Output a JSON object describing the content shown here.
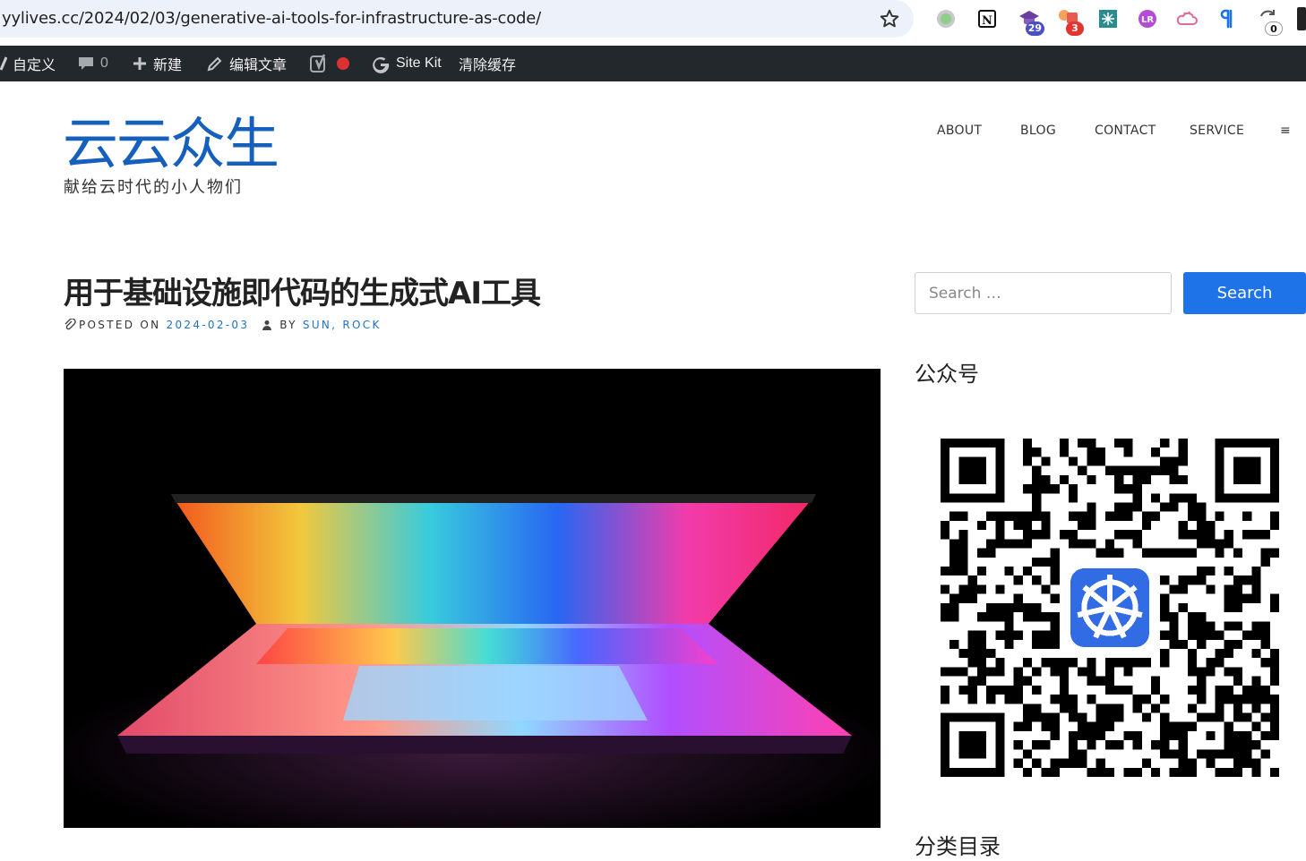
{
  "browser": {
    "url": "yylives.cc/2024/02/03/generative-ai-tools-for-infrastructure-as-code/",
    "extensions": [
      {
        "name": "circle-extension-icon"
      },
      {
        "name": "notion-icon"
      },
      {
        "name": "graduation-cap-icon",
        "badge": "29"
      },
      {
        "name": "shapes-icon",
        "badge": "3"
      },
      {
        "name": "grid-app-icon"
      },
      {
        "name": "lr-icon"
      },
      {
        "name": "cloud-icon"
      },
      {
        "name": "paragraph-icon"
      },
      {
        "name": "refresh-counter-icon",
        "badge": "0"
      }
    ]
  },
  "admin_bar": {
    "customize": "自定义",
    "comments_count": "0",
    "new": "新建",
    "edit_post": "编辑文章",
    "site_kit": "Site Kit",
    "clear_cache": "清除缓存"
  },
  "site": {
    "title": "云云众生",
    "description": "献给云时代的小人物们"
  },
  "nav": {
    "items": [
      "ABOUT",
      "BLOG",
      "CONTACT",
      "SERVICE"
    ],
    "menu_icon": "≡"
  },
  "post": {
    "title": "用于基础设施即代码的生成式AI工具",
    "posted_on_label": "POSTED ON",
    "date": "2024-02-03",
    "by_label": "BY",
    "authors": "SUN, ROCK"
  },
  "sidebar": {
    "search_placeholder": "Search …",
    "search_button": "Search",
    "widget_wechat": "公众号",
    "widget_categories": "分类目录"
  },
  "colors": {
    "accent": "#1e73e8",
    "brand": "#1560bd",
    "admin_bar": "#23282d",
    "link": "#1e73be"
  }
}
